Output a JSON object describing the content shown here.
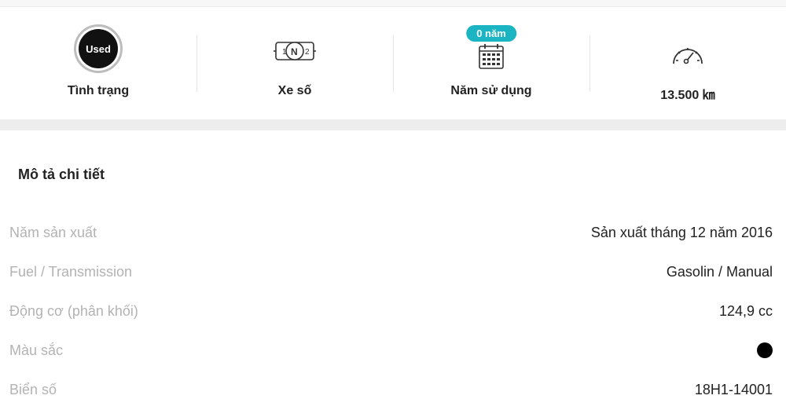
{
  "specs": {
    "condition": {
      "badge": "Used",
      "label": "Tình trạng"
    },
    "transmission": {
      "gear_left": "1",
      "gear_mid": "N",
      "gear_right": "2",
      "label": "Xe số"
    },
    "years_used": {
      "pill": "0 năm",
      "label": "Năm sử dụng"
    },
    "mileage": {
      "label": "13.500 ㎞"
    }
  },
  "section": {
    "title": "Mô tả chi tiết"
  },
  "details": [
    {
      "key": "Năm sản xuất",
      "value": "Sản xuất tháng 12 năm 2016"
    },
    {
      "key": "Fuel / Transmission",
      "value": "Gasolin / Manual"
    },
    {
      "key": "Động cơ (phân khối)",
      "value": "124,9 cc"
    },
    {
      "key": "Màu sắc",
      "value": "",
      "color": "#000000"
    },
    {
      "key": "Biển số",
      "value": "18H1-14001"
    }
  ]
}
